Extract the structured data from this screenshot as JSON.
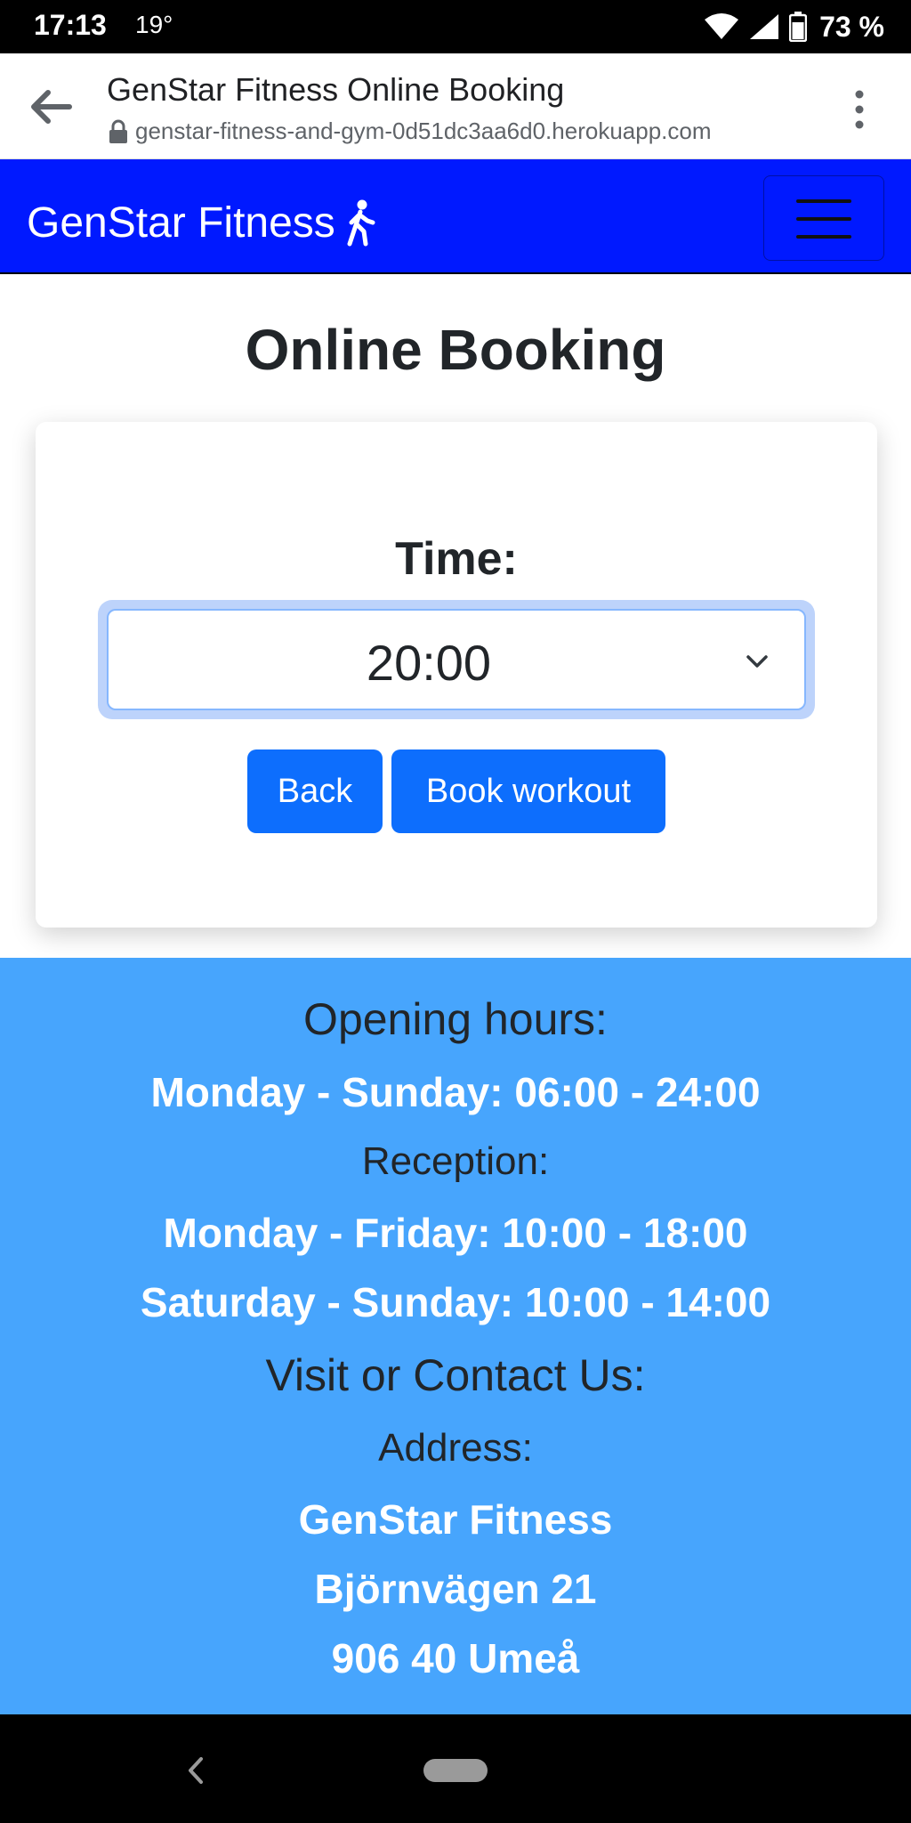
{
  "status_bar": {
    "time": "17:13",
    "temperature": "19°",
    "battery": "73 %"
  },
  "browser": {
    "title": "GenStar Fitness Online Booking",
    "url": "genstar-fitness-and-gym-0d51dc3aa6d0.herokuapp.com"
  },
  "navbar": {
    "brand": "GenStar Fitness",
    "brand_icon": "person-walking-icon",
    "menu_icon": "hamburger-menu-icon",
    "background_color": "#0019ff"
  },
  "main": {
    "title": "Online Booking",
    "time_label": "Time:",
    "time_selected": "20:00",
    "back_label": "Back",
    "book_label": "Book workout",
    "button_color": "#0d6efd"
  },
  "footer": {
    "opening_hours_heading": "Opening hours:",
    "opening_hours": "Monday - Sunday: 06:00 - 24:00",
    "reception_heading": "Reception:",
    "reception_weekdays": "Monday - Friday: 10:00 - 18:00",
    "reception_weekend": "Saturday - Sunday: 10:00 - 14:00",
    "contact_heading": "Visit or Contact Us:",
    "address_heading": "Address:",
    "address_name": "GenStar Fitness",
    "address_street": "Björnvägen 21",
    "address_city": "906 40 Umeå",
    "background_color": "#47a5fd"
  }
}
